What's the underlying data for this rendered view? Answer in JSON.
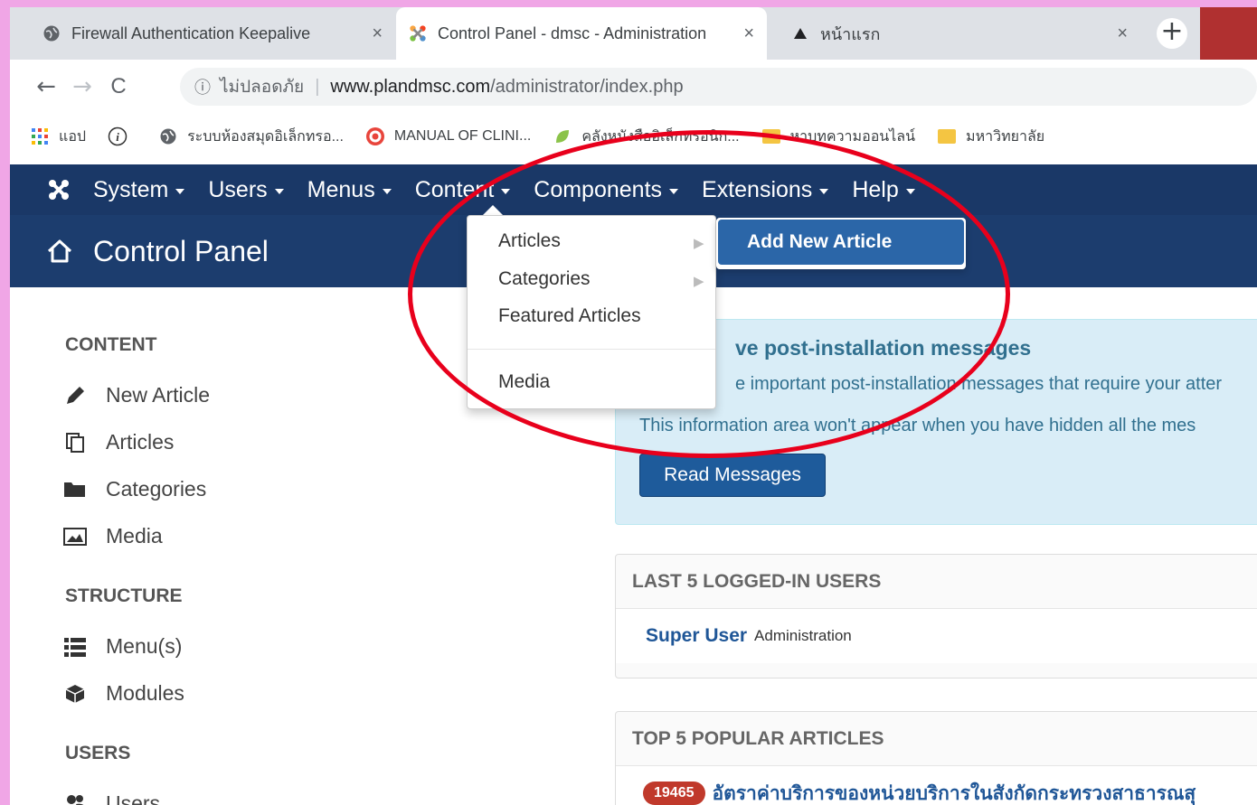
{
  "browser": {
    "tabs": [
      {
        "title": "Firewall Authentication Keepalive",
        "close": "×"
      },
      {
        "title": "Control Panel - dmsc - Administration",
        "close": "×"
      },
      {
        "title": "หน้าแรก",
        "close": "×"
      }
    ],
    "new_tab": "+",
    "nav": {
      "back": "←",
      "forward": "→",
      "reload": "C"
    },
    "address": {
      "info_icon": "ⓘ",
      "security": "ไม่ปลอดภัย",
      "separator": "|",
      "host": "www.plandmsc.com",
      "path": "/administrator/index.php"
    },
    "bookmarks": [
      {
        "label": "แอป",
        "icon": "apps-grid-icon"
      },
      {
        "label": "",
        "icon": "info-circle-icon"
      },
      {
        "label": "ระบบห้องสมุดอิเล็กทรอ...",
        "icon": "globe-icon"
      },
      {
        "label": "MANUAL OF CLINI...",
        "icon": "target-icon"
      },
      {
        "label": "คลังหนังสืออิเล็กทรอนิก...",
        "icon": "leaf-icon"
      },
      {
        "label": "หาบทความออนไลน์",
        "icon": "folder-icon"
      },
      {
        "label": "มหาวิทยาลัย",
        "icon": "folder-icon"
      }
    ]
  },
  "topnav": {
    "items": [
      "System",
      "Users",
      "Menus",
      "Content",
      "Components",
      "Extensions",
      "Help"
    ],
    "open_item": "Content"
  },
  "header": {
    "title": "Control Panel"
  },
  "sidebar": {
    "sections": [
      {
        "title": "CONTENT",
        "items": [
          {
            "label": "New Article",
            "icon": "pencil-icon"
          },
          {
            "label": "Articles",
            "icon": "copy-icon"
          },
          {
            "label": "Categories",
            "icon": "folder-open-icon"
          },
          {
            "label": "Media",
            "icon": "image-icon"
          }
        ]
      },
      {
        "title": "STRUCTURE",
        "items": [
          {
            "label": "Menu(s)",
            "icon": "list-icon"
          },
          {
            "label": "Modules",
            "icon": "cube-icon"
          }
        ]
      },
      {
        "title": "USERS",
        "items": [
          {
            "label": "Users",
            "icon": "users-icon"
          }
        ]
      }
    ]
  },
  "dropdown": {
    "items": [
      "Articles",
      "Categories",
      "Featured Articles",
      "Media"
    ],
    "submenu_item": "Add New Article"
  },
  "alert": {
    "title": "ve post-installation messages",
    "line1": "e important post-installation messages that require your atter",
    "line2": "This information area won't appear when you have hidden all the mes",
    "button": "Read Messages"
  },
  "logged_users": {
    "title": "LAST 5 LOGGED-IN USERS",
    "rows": [
      {
        "name": "Super User",
        "location": "Administration"
      }
    ]
  },
  "popular": {
    "title": "TOP 5 POPULAR ARTICLES",
    "rows": [
      {
        "hits": "19465",
        "title": "อัตราค่าบริการของหน่วยบริการในสังกัดกระทรวงสาธารณสุ"
      }
    ]
  },
  "colors": {
    "page_border": "#f0a6e6",
    "joomla_nav": "#1a3867",
    "joomla_header": "#1c3d6e",
    "annotation": "#e8001c",
    "badge": "#c0392b"
  }
}
